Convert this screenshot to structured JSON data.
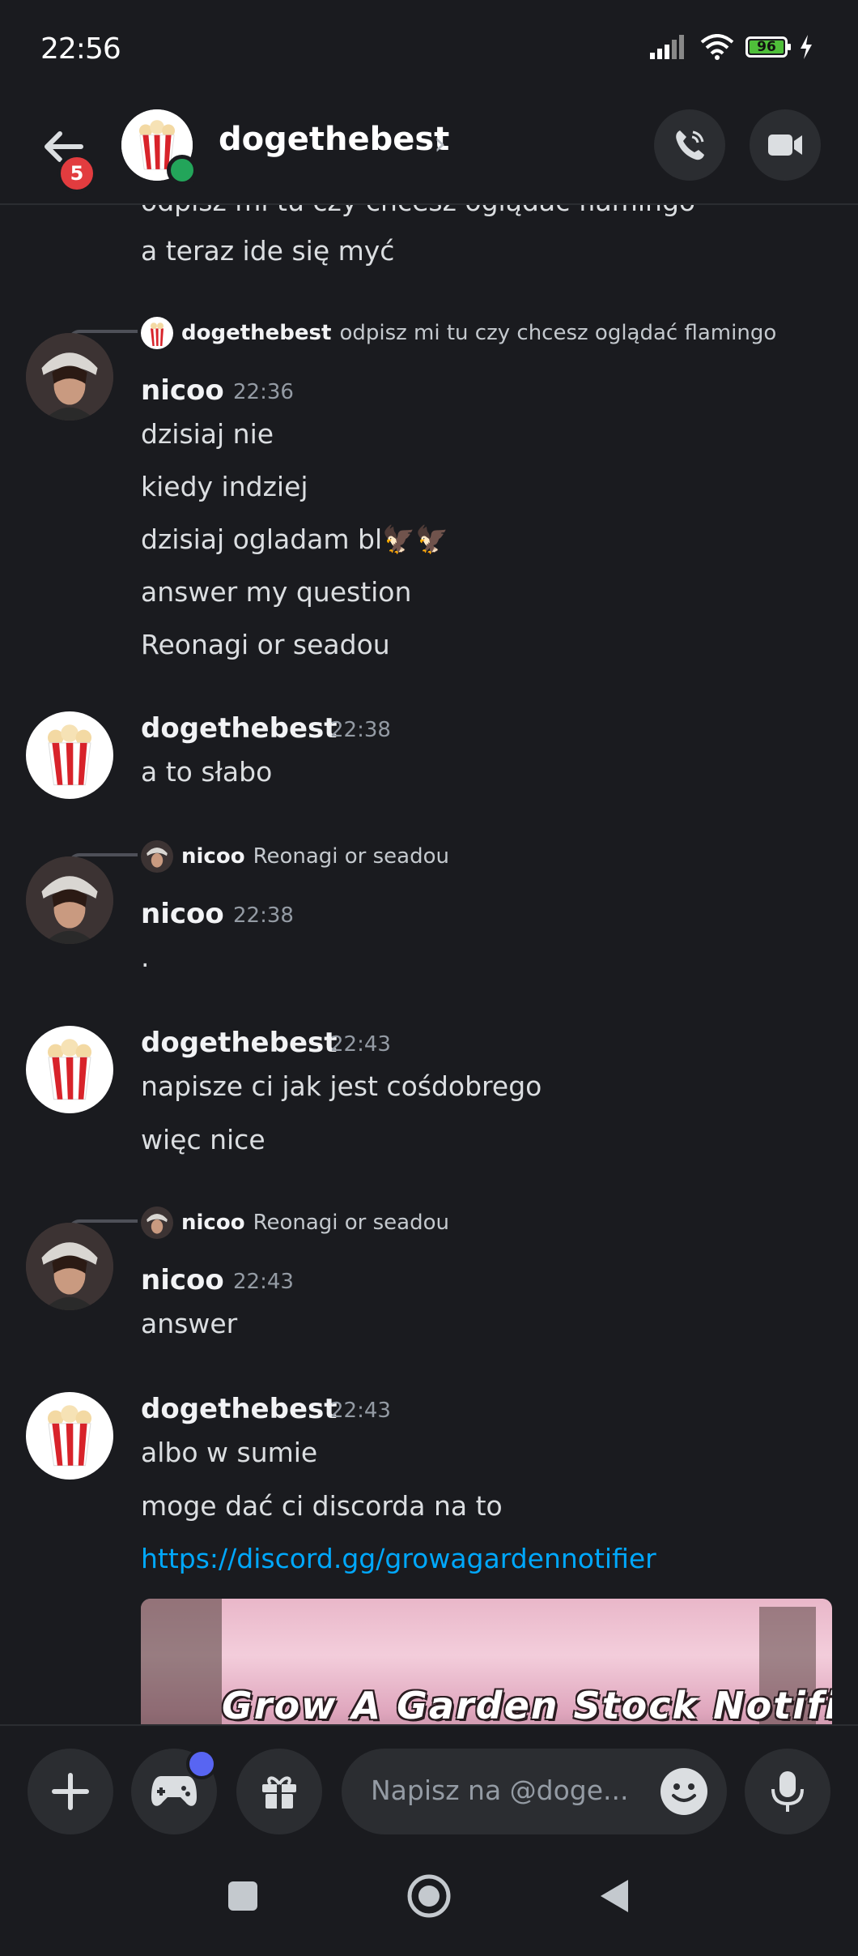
{
  "status_bar": {
    "time": "22:56",
    "battery": "96"
  },
  "header": {
    "name": "dogethebest",
    "badge_count": "5"
  },
  "messages": {
    "cut_top": "odpisz mi tu czy chcesz oglądać flamingo",
    "cut_line2": "a teraz ide się myć",
    "g1": {
      "reply_author": "dogethebest",
      "reply_text": "odpisz mi tu czy chcesz oglądać flamingo",
      "author": "nicoo",
      "time": "22:36",
      "lines": [
        "dzisiaj nie",
        "kiedy indziej",
        "dzisiaj ogladam bl🦅🦅",
        "answer my question",
        "Reonagi or seadou"
      ]
    },
    "g2": {
      "author": "dogethebest",
      "time": "22:38",
      "lines": [
        "a to słabo"
      ]
    },
    "g3": {
      "reply_author": "nicoo",
      "reply_text": "Reonagi or seadou",
      "author": "nicoo",
      "time": "22:38",
      "lines": [
        "."
      ]
    },
    "g4": {
      "author": "dogethebest",
      "time": "22:43",
      "lines": [
        "napisze ci jak jest cośdobrego",
        "więc nice"
      ]
    },
    "g5": {
      "reply_author": "nicoo",
      "reply_text": "Reonagi or seadou",
      "author": "nicoo",
      "time": "22:43",
      "lines": [
        "answer"
      ]
    },
    "g6": {
      "author": "dogethebest",
      "time": "22:43",
      "lines": [
        "albo w sumie",
        "moge dać ci discorda na to",
        "https://discord.gg/growagardennotifier"
      ],
      "embed_title": "Grow A Garden Stock Notifier"
    }
  },
  "composer": {
    "placeholder": "Napisz na @doge..."
  },
  "icons": [
    "back-arrow-icon",
    "chevron-right-icon",
    "phone-icon",
    "video-icon",
    "plus-icon",
    "gamepad-icon",
    "gift-icon",
    "emoji-icon",
    "mic-icon",
    "square-icon",
    "circle-icon",
    "triangle-icon"
  ],
  "colors": {
    "background": "#1a1b1f",
    "link": "#00a8fc",
    "online": "#23a55a",
    "badge": "#e23c3f",
    "accent": "#5865f2"
  }
}
